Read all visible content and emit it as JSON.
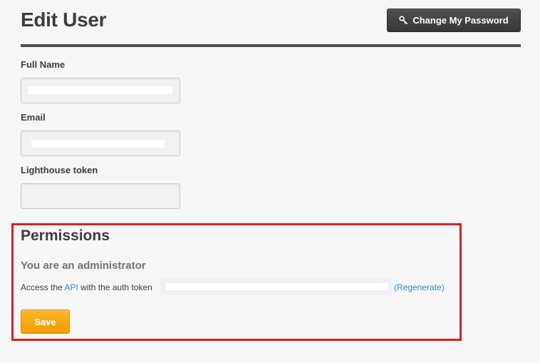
{
  "header": {
    "title": "Edit User",
    "change_password_label": "Change My Password",
    "change_password_icon": "key-icon"
  },
  "form": {
    "full_name": {
      "label": "Full Name",
      "value": ""
    },
    "email": {
      "label": "Email",
      "value": ""
    },
    "lighthouse_token": {
      "label": "Lighthouse token",
      "value": ""
    }
  },
  "permissions": {
    "title": "Permissions",
    "status": "You are an administrator",
    "api_prefix": "Access the",
    "api_link": "API",
    "api_suffix": "with the auth token",
    "regenerate_link": "(Regenerate)",
    "highlight_color": "#e01d1d"
  },
  "actions": {
    "save_label": "Save"
  }
}
